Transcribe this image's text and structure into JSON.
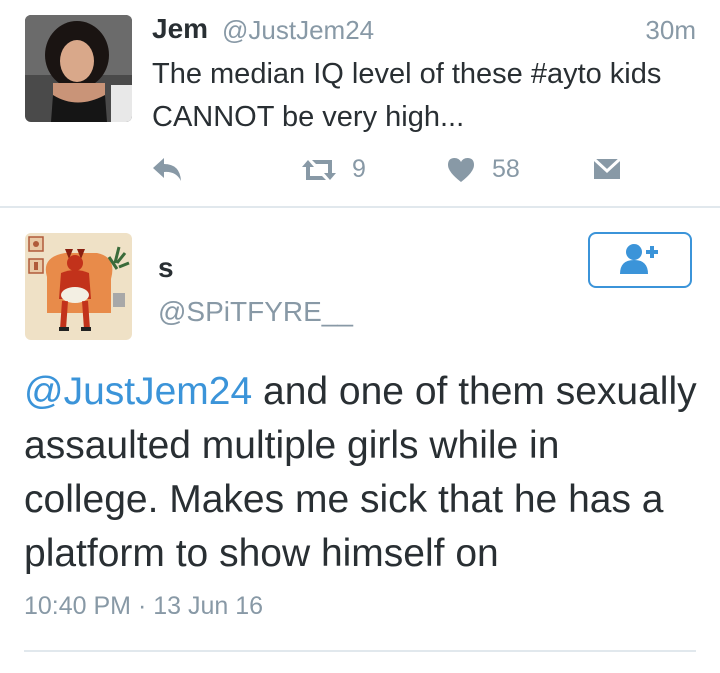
{
  "top_tweet": {
    "name": "Jem",
    "handle": "@JustJem24",
    "time": "30m",
    "text": "The median IQ level of these #ayto kids CANNOT be very high...",
    "retweet_count": "9",
    "like_count": "58",
    "icons": [
      "reply-icon",
      "retweet-icon",
      "heart-icon",
      "message-icon"
    ]
  },
  "main_tweet": {
    "name": "s",
    "handle": "@SPiTFYRE__",
    "mention": "@JustJem24",
    "text": " and one of them sexually assaulted multiple girls while in college. Makes me sick that he has a platform to show himself on",
    "timestamp": "10:40 PM · 13 Jun 16",
    "follow_icon": "add-user-icon"
  },
  "colors": {
    "text": "#292f33",
    "muted": "#8899a6",
    "accent": "#3b94d9",
    "divider": "#e1e8ed"
  }
}
